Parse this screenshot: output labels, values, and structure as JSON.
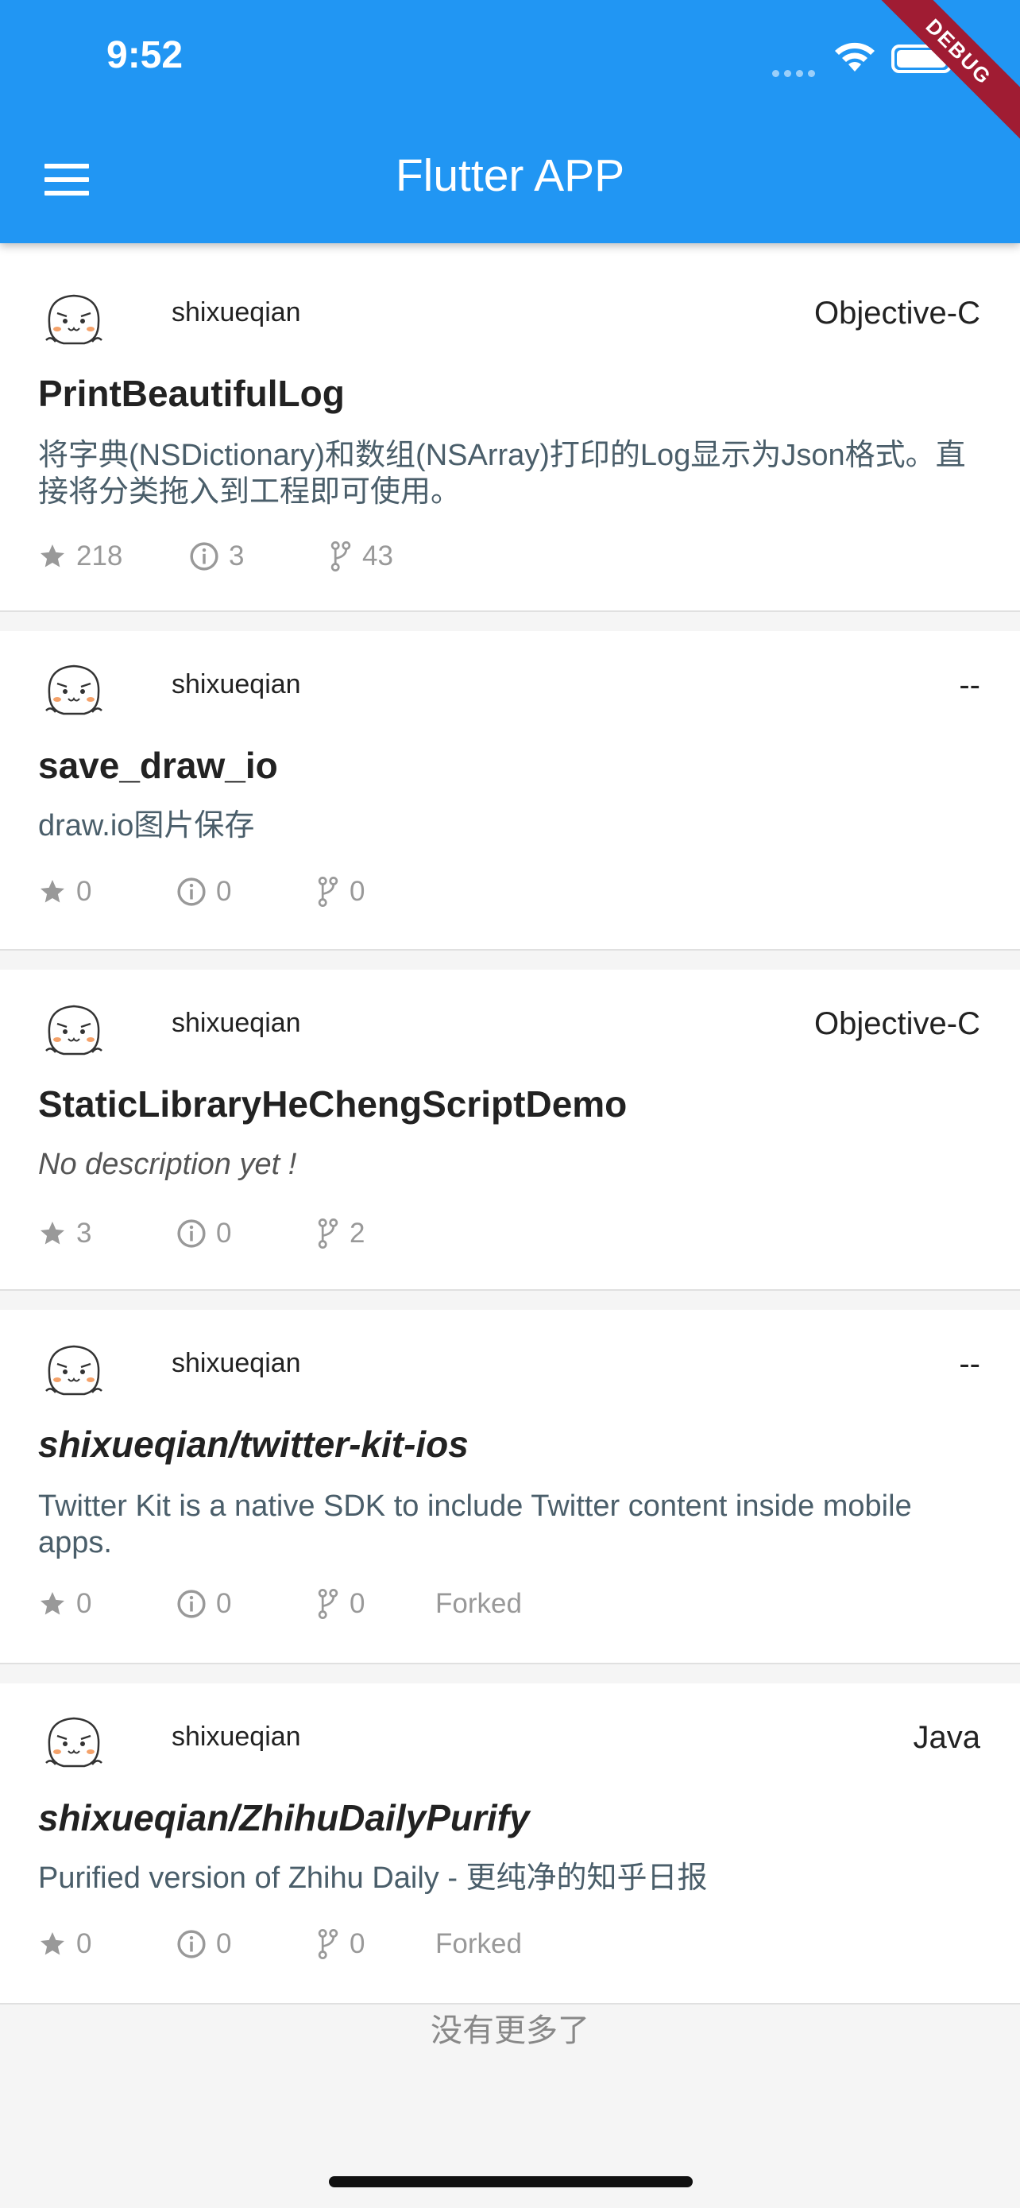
{
  "status_bar": {
    "time": "9:52"
  },
  "debug_banner": "DEBUG",
  "app_bar": {
    "title": "Flutter APP",
    "menu_icon": "menu-icon"
  },
  "repos": [
    {
      "owner": "shixueqian",
      "language": "Objective-C",
      "name": "PrintBeautifulLog",
      "description": "将字典(NSDictionary)和数组(NSArray)打印的Log显示为Json格式。直接将分类拖入到工程即可使用。",
      "stars": "218",
      "issues": "3",
      "forks": "43",
      "forked": ""
    },
    {
      "owner": "shixueqian",
      "language": "--",
      "name": "save_draw_io",
      "description": "draw.io图片保存",
      "stars": "0",
      "issues": "0",
      "forks": "0",
      "forked": ""
    },
    {
      "owner": "shixueqian",
      "language": "Objective-C",
      "name": "StaticLibraryHeChengScriptDemo",
      "description": "No description yet !",
      "stars": "3",
      "issues": "0",
      "forks": "2",
      "forked": ""
    },
    {
      "owner": "shixueqian",
      "language": "--",
      "name": "shixueqian/twitter-kit-ios",
      "description": "Twitter Kit is a native SDK to include Twitter content inside mobile apps.",
      "stars": "0",
      "issues": "0",
      "forks": "0",
      "forked": "Forked"
    },
    {
      "owner": "shixueqian",
      "language": "Java",
      "name": "shixueqian/ZhihuDailyPurify",
      "description": "Purified version of Zhihu Daily - 更纯净的知乎日报",
      "stars": "0",
      "issues": "0",
      "forks": "0",
      "forked": "Forked"
    }
  ],
  "footer": {
    "no_more": "没有更多了"
  },
  "colors": {
    "app_bar": "#2196f3",
    "debug_ribbon": "#a01c33",
    "description": "#4a5e6a",
    "stat_gray": "#999999"
  }
}
